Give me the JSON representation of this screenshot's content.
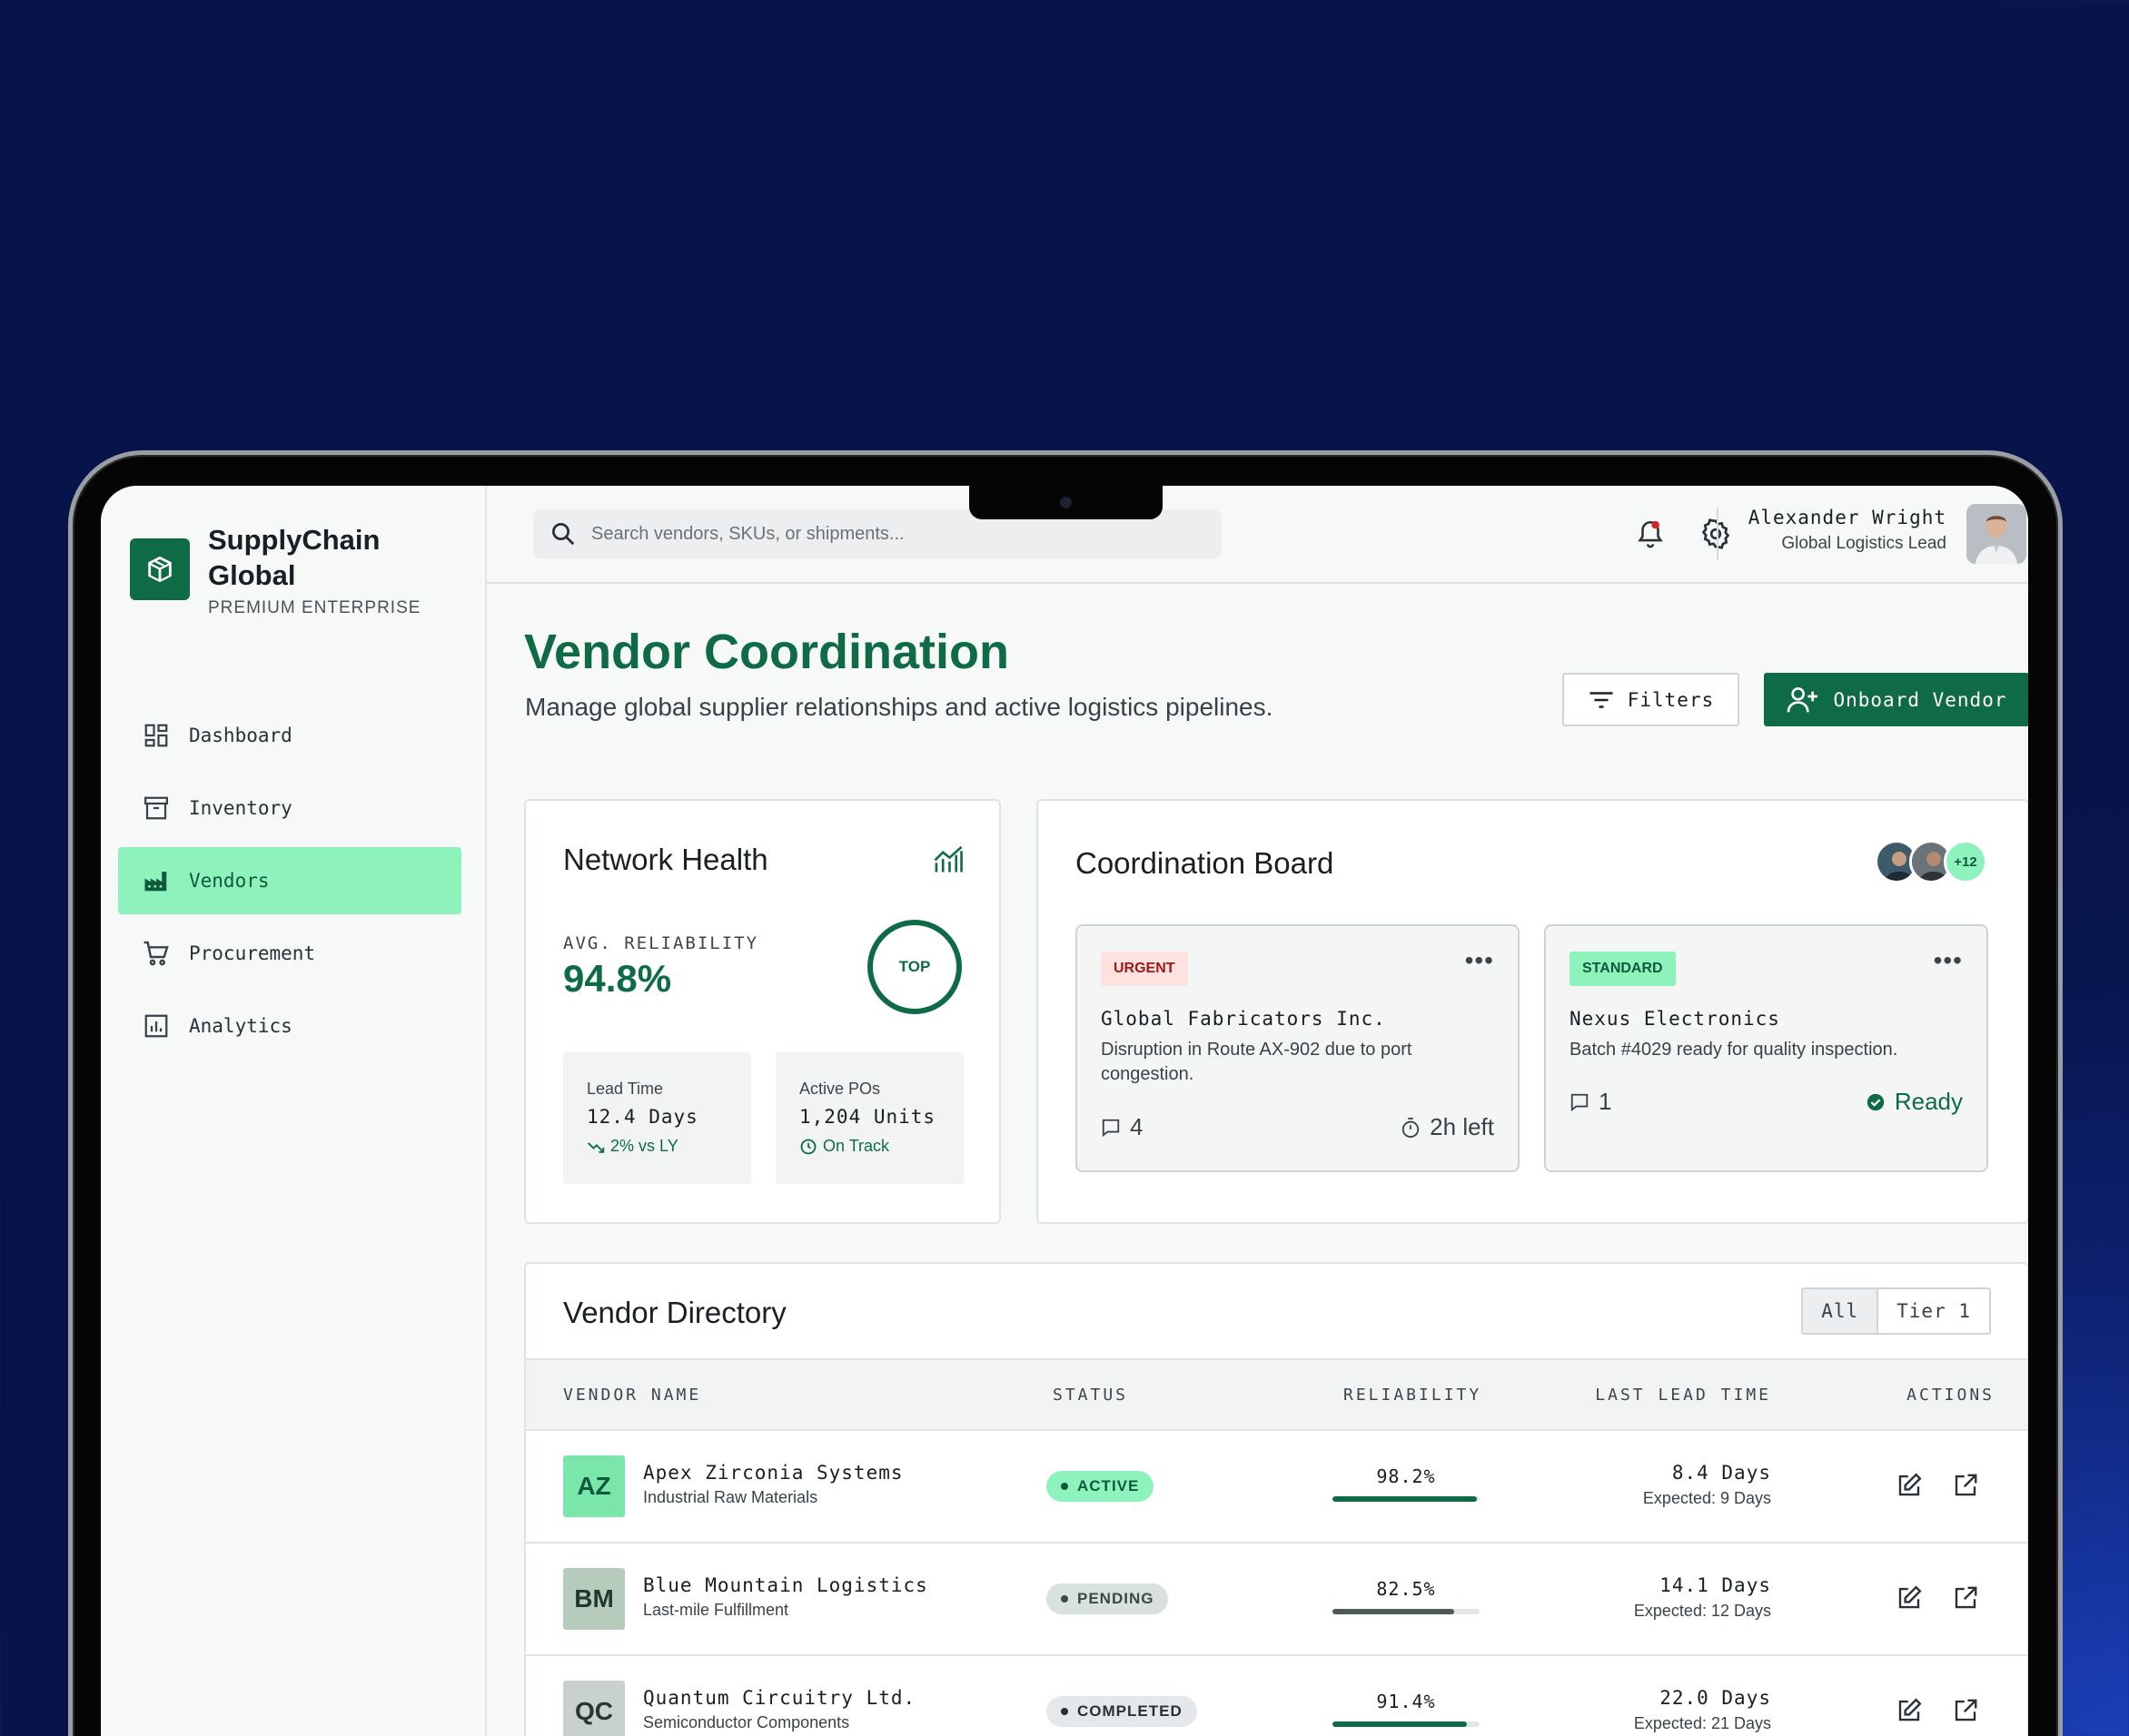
{
  "brand": {
    "name_line1": "SupplyChain",
    "name_line2": "Global",
    "tier": "PREMIUM ENTERPRISE",
    "logo_icon": "package-icon"
  },
  "nav": [
    {
      "label": "Dashboard",
      "icon": "dashboard-icon",
      "active": false
    },
    {
      "label": "Inventory",
      "icon": "inventory-icon",
      "active": false
    },
    {
      "label": "Vendors",
      "icon": "factory-icon",
      "active": true
    },
    {
      "label": "Procurement",
      "icon": "cart-icon",
      "active": false
    },
    {
      "label": "Analytics",
      "icon": "analytics-icon",
      "active": false
    }
  ],
  "search": {
    "placeholder": "Search vendors, SKUs, or shipments..."
  },
  "user": {
    "name": "Alexander Wright",
    "role": "Global Logistics Lead"
  },
  "page": {
    "title": "Vendor Coordination",
    "subtitle": "Manage global supplier relationships and active logistics pipelines.",
    "filters_label": "Filters",
    "onboard_label": "Onboard Vendor"
  },
  "network_health": {
    "title": "Network Health",
    "reliability_label": "AVG. RELIABILITY",
    "reliability_value": "94.8%",
    "ring_label": "TOP",
    "lead_time": {
      "label": "Lead Time",
      "value": "12.4 Days",
      "sub": "2% vs LY"
    },
    "active_pos": {
      "label": "Active POs",
      "value": "1,204 Units",
      "sub": "On Track"
    }
  },
  "coordination_board": {
    "title": "Coordination Board",
    "extra_members": "+12",
    "tasks": [
      {
        "tag": "URGENT",
        "name": "Global Fabricators Inc.",
        "desc": "Disruption in Route AX-902 due to port congestion.",
        "comments": "4",
        "meta": "2h left"
      },
      {
        "tag": "STANDARD",
        "name": "Nexus Electronics",
        "desc": "Batch #4029 ready for quality inspection.",
        "comments": "1",
        "meta": "Ready"
      }
    ]
  },
  "directory": {
    "title": "Vendor Directory",
    "filters": [
      "All",
      "Tier 1"
    ],
    "columns": [
      "VENDOR NAME",
      "STATUS",
      "RELIABILITY",
      "LAST LEAD TIME",
      "ACTIONS"
    ],
    "rows": [
      {
        "initials": "AZ",
        "name": "Apex Zirconia Systems",
        "category": "Industrial Raw Materials",
        "status": "ACTIVE",
        "reliability": "98.2%",
        "reliability_fraction": 0.982,
        "lead": "8.4 Days",
        "expected": "Expected: 9 Days"
      },
      {
        "initials": "BM",
        "name": "Blue Mountain Logistics",
        "category": "Last-mile Fulfillment",
        "status": "PENDING",
        "reliability": "82.5%",
        "reliability_fraction": 0.825,
        "lead": "14.1 Days",
        "expected": "Expected: 12 Days"
      },
      {
        "initials": "QC",
        "name": "Quantum Circuitry Ltd.",
        "category": "Semiconductor Components",
        "status": "COMPLETED",
        "reliability": "91.4%",
        "reliability_fraction": 0.914,
        "lead": "22.0 Days",
        "expected": "Expected: 21 Days"
      }
    ]
  },
  "colors": {
    "brand_green": "#0f6b45",
    "accent_mint": "#8ef2bc",
    "urgent_red": "#a11818",
    "background_navy": "#081650"
  }
}
